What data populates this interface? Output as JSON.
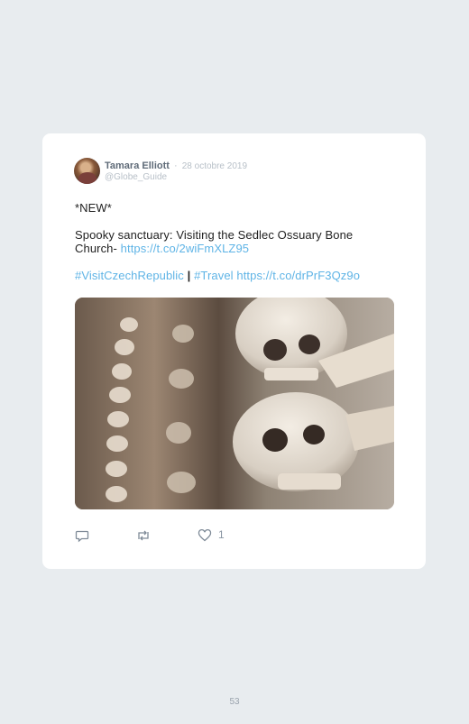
{
  "tweet": {
    "author_name": "Tamara Elliott",
    "separator": "·",
    "date": "28 octobre 2019",
    "handle": "@Globe_Guide",
    "line1": "*NEW*",
    "line2": "Spooky sanctuary: Visiting the Sedlec Ossuary Bone",
    "line3_text": "Church- ",
    "line3_link": "https://t.co/2wiFmXLZ95",
    "hashtag1": "#VisitCzechRepublic",
    "pipe": "|",
    "hashtag2": "#Travel",
    "link2": "https://t.co/drPrF3Qz9o",
    "likes": "1"
  },
  "icons": [
    "reply-icon",
    "retweet-icon",
    "heart-icon"
  ],
  "colors": {
    "link": "#5fb4e6",
    "background": "#e8ecef",
    "card": "#ffffff"
  },
  "page": {
    "number": "53"
  }
}
